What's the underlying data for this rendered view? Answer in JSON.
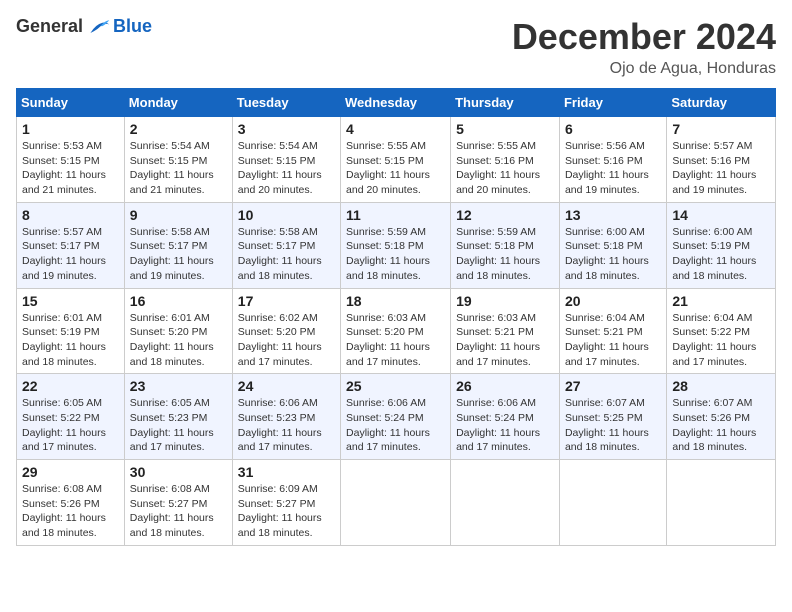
{
  "header": {
    "logo": {
      "general": "General",
      "blue": "Blue"
    },
    "title": "December 2024",
    "subtitle": "Ojo de Agua, Honduras"
  },
  "weekdays": [
    "Sunday",
    "Monday",
    "Tuesday",
    "Wednesday",
    "Thursday",
    "Friday",
    "Saturday"
  ],
  "weeks": [
    [
      {
        "day": "1",
        "info": "Sunrise: 5:53 AM\nSunset: 5:15 PM\nDaylight: 11 hours\nand 21 minutes."
      },
      {
        "day": "2",
        "info": "Sunrise: 5:54 AM\nSunset: 5:15 PM\nDaylight: 11 hours\nand 21 minutes."
      },
      {
        "day": "3",
        "info": "Sunrise: 5:54 AM\nSunset: 5:15 PM\nDaylight: 11 hours\nand 20 minutes."
      },
      {
        "day": "4",
        "info": "Sunrise: 5:55 AM\nSunset: 5:15 PM\nDaylight: 11 hours\nand 20 minutes."
      },
      {
        "day": "5",
        "info": "Sunrise: 5:55 AM\nSunset: 5:16 PM\nDaylight: 11 hours\nand 20 minutes."
      },
      {
        "day": "6",
        "info": "Sunrise: 5:56 AM\nSunset: 5:16 PM\nDaylight: 11 hours\nand 19 minutes."
      },
      {
        "day": "7",
        "info": "Sunrise: 5:57 AM\nSunset: 5:16 PM\nDaylight: 11 hours\nand 19 minutes."
      }
    ],
    [
      {
        "day": "8",
        "info": "Sunrise: 5:57 AM\nSunset: 5:17 PM\nDaylight: 11 hours\nand 19 minutes."
      },
      {
        "day": "9",
        "info": "Sunrise: 5:58 AM\nSunset: 5:17 PM\nDaylight: 11 hours\nand 19 minutes."
      },
      {
        "day": "10",
        "info": "Sunrise: 5:58 AM\nSunset: 5:17 PM\nDaylight: 11 hours\nand 18 minutes."
      },
      {
        "day": "11",
        "info": "Sunrise: 5:59 AM\nSunset: 5:18 PM\nDaylight: 11 hours\nand 18 minutes."
      },
      {
        "day": "12",
        "info": "Sunrise: 5:59 AM\nSunset: 5:18 PM\nDaylight: 11 hours\nand 18 minutes."
      },
      {
        "day": "13",
        "info": "Sunrise: 6:00 AM\nSunset: 5:18 PM\nDaylight: 11 hours\nand 18 minutes."
      },
      {
        "day": "14",
        "info": "Sunrise: 6:00 AM\nSunset: 5:19 PM\nDaylight: 11 hours\nand 18 minutes."
      }
    ],
    [
      {
        "day": "15",
        "info": "Sunrise: 6:01 AM\nSunset: 5:19 PM\nDaylight: 11 hours\nand 18 minutes."
      },
      {
        "day": "16",
        "info": "Sunrise: 6:01 AM\nSunset: 5:20 PM\nDaylight: 11 hours\nand 18 minutes."
      },
      {
        "day": "17",
        "info": "Sunrise: 6:02 AM\nSunset: 5:20 PM\nDaylight: 11 hours\nand 17 minutes."
      },
      {
        "day": "18",
        "info": "Sunrise: 6:03 AM\nSunset: 5:20 PM\nDaylight: 11 hours\nand 17 minutes."
      },
      {
        "day": "19",
        "info": "Sunrise: 6:03 AM\nSunset: 5:21 PM\nDaylight: 11 hours\nand 17 minutes."
      },
      {
        "day": "20",
        "info": "Sunrise: 6:04 AM\nSunset: 5:21 PM\nDaylight: 11 hours\nand 17 minutes."
      },
      {
        "day": "21",
        "info": "Sunrise: 6:04 AM\nSunset: 5:22 PM\nDaylight: 11 hours\nand 17 minutes."
      }
    ],
    [
      {
        "day": "22",
        "info": "Sunrise: 6:05 AM\nSunset: 5:22 PM\nDaylight: 11 hours\nand 17 minutes."
      },
      {
        "day": "23",
        "info": "Sunrise: 6:05 AM\nSunset: 5:23 PM\nDaylight: 11 hours\nand 17 minutes."
      },
      {
        "day": "24",
        "info": "Sunrise: 6:06 AM\nSunset: 5:23 PM\nDaylight: 11 hours\nand 17 minutes."
      },
      {
        "day": "25",
        "info": "Sunrise: 6:06 AM\nSunset: 5:24 PM\nDaylight: 11 hours\nand 17 minutes."
      },
      {
        "day": "26",
        "info": "Sunrise: 6:06 AM\nSunset: 5:24 PM\nDaylight: 11 hours\nand 17 minutes."
      },
      {
        "day": "27",
        "info": "Sunrise: 6:07 AM\nSunset: 5:25 PM\nDaylight: 11 hours\nand 18 minutes."
      },
      {
        "day": "28",
        "info": "Sunrise: 6:07 AM\nSunset: 5:26 PM\nDaylight: 11 hours\nand 18 minutes."
      }
    ],
    [
      {
        "day": "29",
        "info": "Sunrise: 6:08 AM\nSunset: 5:26 PM\nDaylight: 11 hours\nand 18 minutes."
      },
      {
        "day": "30",
        "info": "Sunrise: 6:08 AM\nSunset: 5:27 PM\nDaylight: 11 hours\nand 18 minutes."
      },
      {
        "day": "31",
        "info": "Sunrise: 6:09 AM\nSunset: 5:27 PM\nDaylight: 11 hours\nand 18 minutes."
      },
      null,
      null,
      null,
      null
    ]
  ]
}
